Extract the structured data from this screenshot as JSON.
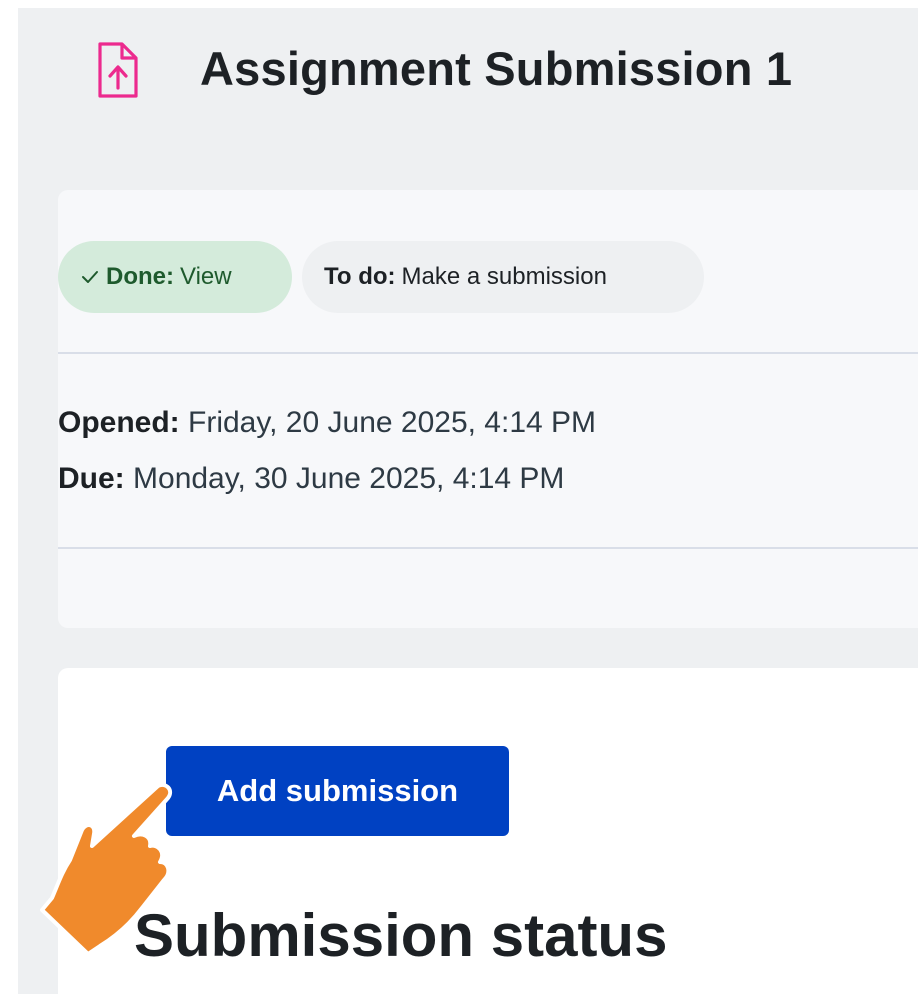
{
  "header": {
    "title": "Assignment Submission 1",
    "icon": "file-upload-icon",
    "icon_color": "#ec2a8e"
  },
  "completion": {
    "done_label": "Done:",
    "done_text": "View",
    "todo_label": "To do:",
    "todo_text": "Make a submission"
  },
  "dates": {
    "opened_label": "Opened:",
    "opened_value": "Friday, 20 June 2025, 4:14 PM",
    "due_label": "Due:",
    "due_value": "Monday, 30 June 2025, 4:14 PM"
  },
  "actions": {
    "add_submission_label": "Add submission"
  },
  "submission": {
    "section_title": "Submission status"
  },
  "colors": {
    "primary_button": "#0041c2",
    "done_pill_bg": "#d4ebdb",
    "pointer_hand": "#f08a2c"
  }
}
